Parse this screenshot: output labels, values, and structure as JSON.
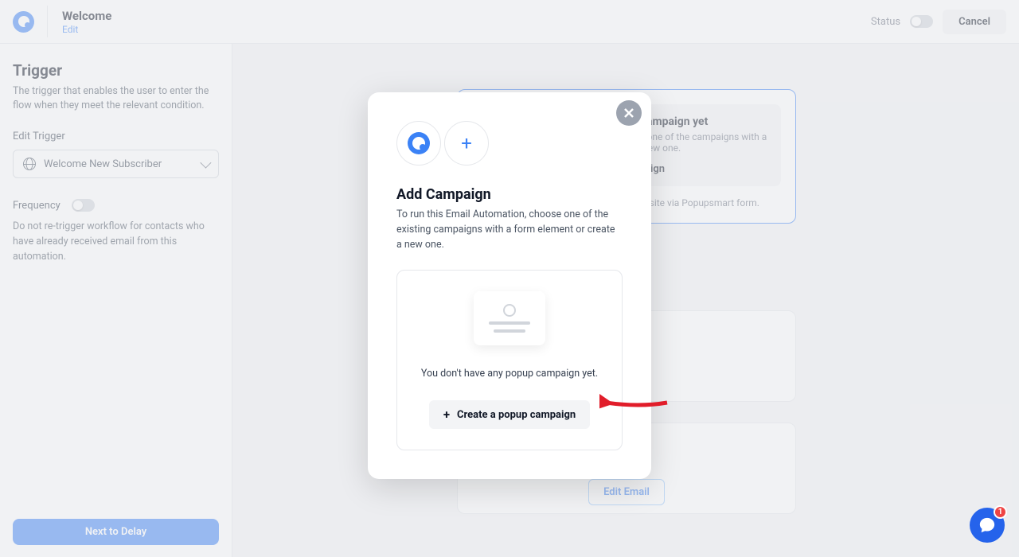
{
  "header": {
    "title": "Welcome",
    "edit": "Edit",
    "status_label": "Status",
    "cancel": "Cancel"
  },
  "sidebar": {
    "trigger_heading": "Trigger",
    "trigger_desc": "The trigger that enables the user to enter the flow when they meet the relevant condition.",
    "edit_trigger_label": "Edit Trigger",
    "trigger_select": "Welcome New Subscriber",
    "frequency_label": "Frequency",
    "frequency_desc": "Do not re-trigger workflow for contacts who have already received email from this automation.",
    "next_button": "Next to Delay"
  },
  "canvas": {
    "no_campaign_title": "You don't have any campaign yet",
    "no_campaign_desc": "To run this Email Automation, choose one of the campaigns with a form or create a new one.",
    "add_campaign_link": "+ Add Campaign",
    "footer_hint": "A new lead signs up through the website via Popupsmart form.",
    "edit_email": "Edit Email"
  },
  "modal": {
    "title": "Add Campaign",
    "desc": "To run this Email Automation, choose one of the existing campaigns with a form element or create a new one.",
    "empty_text": "You don't have any popup campaign yet.",
    "create_button": "Create a popup campaign"
  },
  "chat": {
    "badge": "1"
  }
}
